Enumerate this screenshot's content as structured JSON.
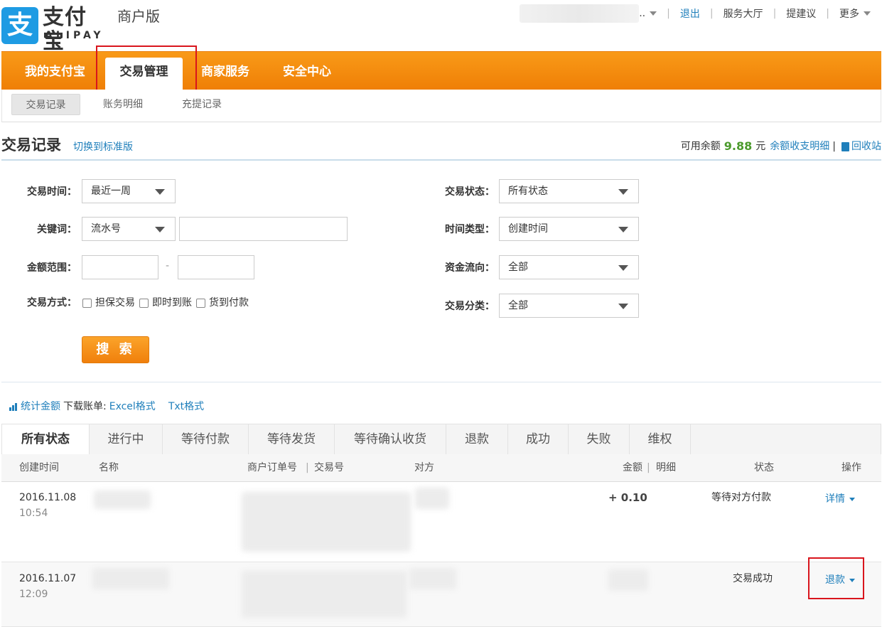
{
  "header": {
    "logo_char": "支",
    "logo_cn": "支付宝",
    "logo_en": "ALIPAY",
    "sub_title": "商户版",
    "user_suffix": "..",
    "links": [
      "退出",
      "服务大厅",
      "提建议",
      "更多"
    ]
  },
  "nav": {
    "items": [
      "我的支付宝",
      "交易管理",
      "商家服务",
      "安全中心"
    ],
    "active": "交易管理"
  },
  "subnav": {
    "items": [
      "交易记录",
      "账务明细",
      "充提记录"
    ],
    "active": "交易记录"
  },
  "page": {
    "title": "交易记录",
    "switch_link": "切换到标准版",
    "balance_label": "可用余额",
    "balance_value": "9.88",
    "balance_unit": "元",
    "balance_detail_link": "余额收支明细",
    "recycle_link": "回收站"
  },
  "filter": {
    "time_label": "交易时间：",
    "time_value": "最近一周",
    "keyword_label": "关键词：",
    "keyword_type": "流水号",
    "keyword_value": "",
    "amount_label": "金额范围：",
    "amount_min": "",
    "amount_sep": "-",
    "amount_max": "",
    "method_label": "交易方式：",
    "methods": [
      "担保交易",
      "即时到账",
      "货到付款"
    ],
    "status_label": "交易状态：",
    "status_value": "所有状态",
    "time_type_label": "时间类型：",
    "time_type_value": "创建时间",
    "flow_label": "资金流向：",
    "flow_value": "全部",
    "category_label": "交易分类：",
    "category_value": "全部",
    "search_button": "搜 索"
  },
  "stats": {
    "stat_link": "统计金额",
    "download_label": "下载账单:",
    "excel_link": "Excel格式",
    "txt_link": "Txt格式"
  },
  "tabs": [
    "所有状态",
    "进行中",
    "等待付款",
    "等待发货",
    "等待确认收货",
    "退款",
    "成功",
    "失败",
    "维权"
  ],
  "table": {
    "columns": {
      "time": "创建时间",
      "name": "名称",
      "order": "商户订单号",
      "trade_no": "交易号",
      "counterparty": "对方",
      "amount": "金额",
      "detail": "明细",
      "status": "状态",
      "action": "操作"
    },
    "rows": [
      {
        "date": "2016.11.08",
        "time": "10:54",
        "amount": "+ 0.10",
        "status": "等待对方付款",
        "action": "详情"
      },
      {
        "date": "2016.11.07",
        "time": "12:09",
        "amount": "",
        "status": "交易成功",
        "action": "退款"
      }
    ]
  },
  "colors": {
    "nav_orange": "#f48b10",
    "link_blue": "#1f7fbb",
    "balance_green": "#4b9a2c",
    "highlight_red": "#d9151d",
    "logo_blue": "#1e9be3"
  }
}
